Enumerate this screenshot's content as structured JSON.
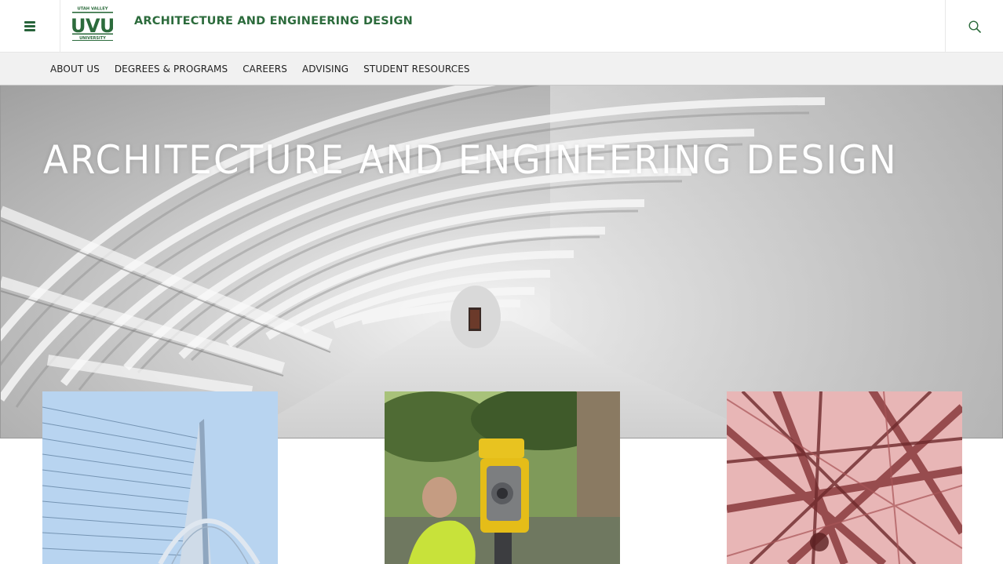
{
  "header": {
    "menu_icon": "hamburger-menu-icon",
    "logo": {
      "line1": "UTAH VALLEY",
      "line2": "UVU",
      "line3": "UNIVERSITY"
    },
    "site_title": "ARCHITECTURE AND ENGINEERING DESIGN",
    "search_icon": "search-icon"
  },
  "nav": {
    "items": [
      {
        "label": "ABOUT US"
      },
      {
        "label": "DEGREES & PROGRAMS"
      },
      {
        "label": "CAREERS"
      },
      {
        "label": "ADVISING"
      },
      {
        "label": "STUDENT RESOURCES"
      }
    ]
  },
  "hero": {
    "title": "ARCHITECTURE AND ENGINEERING DESIGN"
  },
  "cards": [
    {
      "image": "cable-bridge-photo"
    },
    {
      "image": "surveyor-total-station-photo"
    },
    {
      "image": "steel-beams-photo"
    }
  ],
  "colors": {
    "brand_green": "#2c6b3c",
    "nav_bg": "#f1f1f1"
  }
}
